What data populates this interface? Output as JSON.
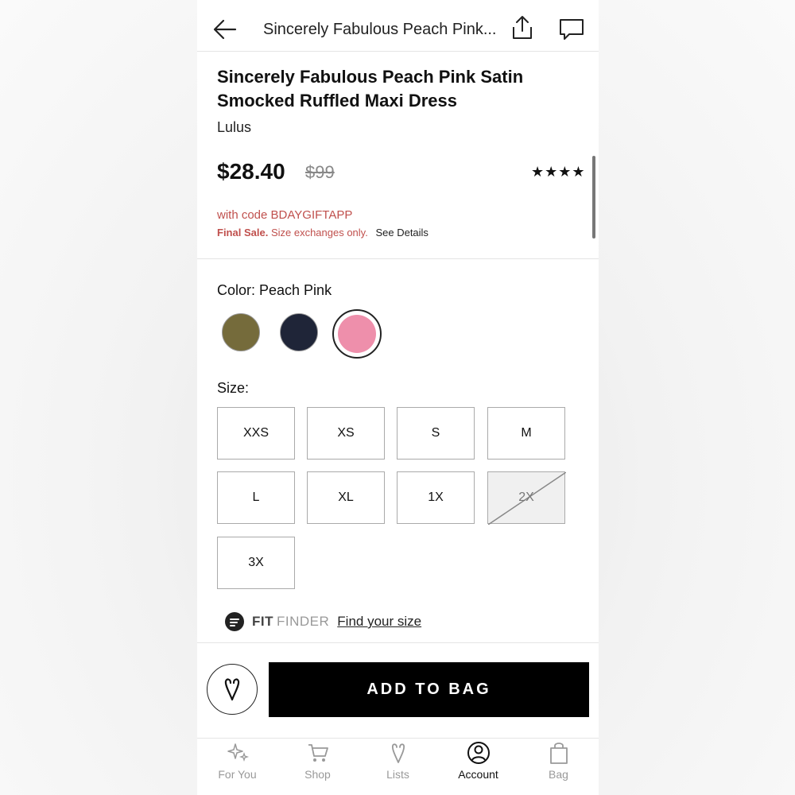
{
  "header": {
    "title": "Sincerely Fabulous Peach Pink..."
  },
  "product": {
    "title": "Sincerely Fabulous Peach Pink Satin Smocked Ruffled Maxi Dress",
    "brand": "Lulus",
    "price": "$28.40",
    "original_price": "$99",
    "rating_stars": 4,
    "promo_code_text": "with code BDAYGIFTAPP",
    "final_sale": "Final Sale.",
    "final_sale_note": "Size exchanges only.",
    "see_details": "See Details"
  },
  "color": {
    "label": "Color: Peach Pink",
    "swatches": [
      {
        "name": "olive",
        "hex": "#756b3b"
      },
      {
        "name": "navy",
        "hex": "#1f2538"
      },
      {
        "name": "peach-pink",
        "hex": "#ee8fab",
        "selected": true
      }
    ]
  },
  "size": {
    "label": "Size:",
    "options": [
      "XXS",
      "XS",
      "S",
      "M",
      "L",
      "XL",
      "1X",
      "2X",
      "3X"
    ],
    "unavailable": [
      "2X"
    ]
  },
  "fit_finder": {
    "name_bold": "FIT",
    "name_light": "FINDER",
    "link": "Find your size"
  },
  "actions": {
    "add_to_bag": "ADD TO BAG"
  },
  "bottom_nav": {
    "items": [
      {
        "label": "For You",
        "icon": "sparkle-icon"
      },
      {
        "label": "Shop",
        "icon": "cart-icon"
      },
      {
        "label": "Lists",
        "icon": "heart-v-icon"
      },
      {
        "label": "Account",
        "icon": "account-icon",
        "active": true
      },
      {
        "label": "Bag",
        "icon": "bag-icon"
      }
    ]
  },
  "colors": {
    "promo": "#c0504d",
    "button": "#000000"
  }
}
